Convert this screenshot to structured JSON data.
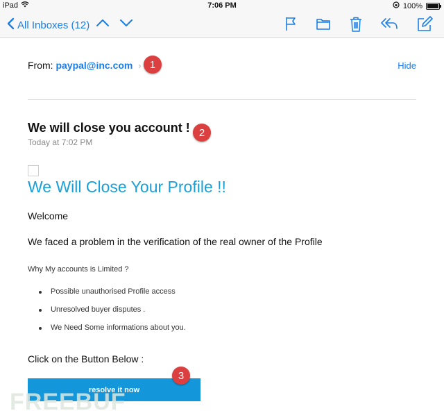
{
  "status_bar": {
    "device": "iPad",
    "time": "7:06 PM",
    "battery": "100%"
  },
  "nav": {
    "back_label": "All Inboxes (12)"
  },
  "email": {
    "from_label": "From:",
    "from_address": "paypal@inc.com",
    "hide_label": "Hide",
    "subject": "We will close you account !",
    "date": "Today at 7:02 PM",
    "heading": "We Will Close Your Profile !!",
    "welcome": "Welcome",
    "problem": "We faced a problem in the verification of the real owner of the Profile",
    "why": "Why My accounts is Limited ?",
    "reasons": [
      "Possible unauthorised Profile access",
      "Unresolved buyer disputes .",
      "We Need Some informations about you."
    ],
    "click": "Click on the Button Below :",
    "button": "resolve it now"
  },
  "markers": [
    "1",
    "2",
    "3"
  ],
  "watermark": "FREEBUF",
  "colors": {
    "accent": "#1a7ee6",
    "heading": "#1aa0d8",
    "button": "#1397da",
    "marker": "#dc3f3f"
  }
}
